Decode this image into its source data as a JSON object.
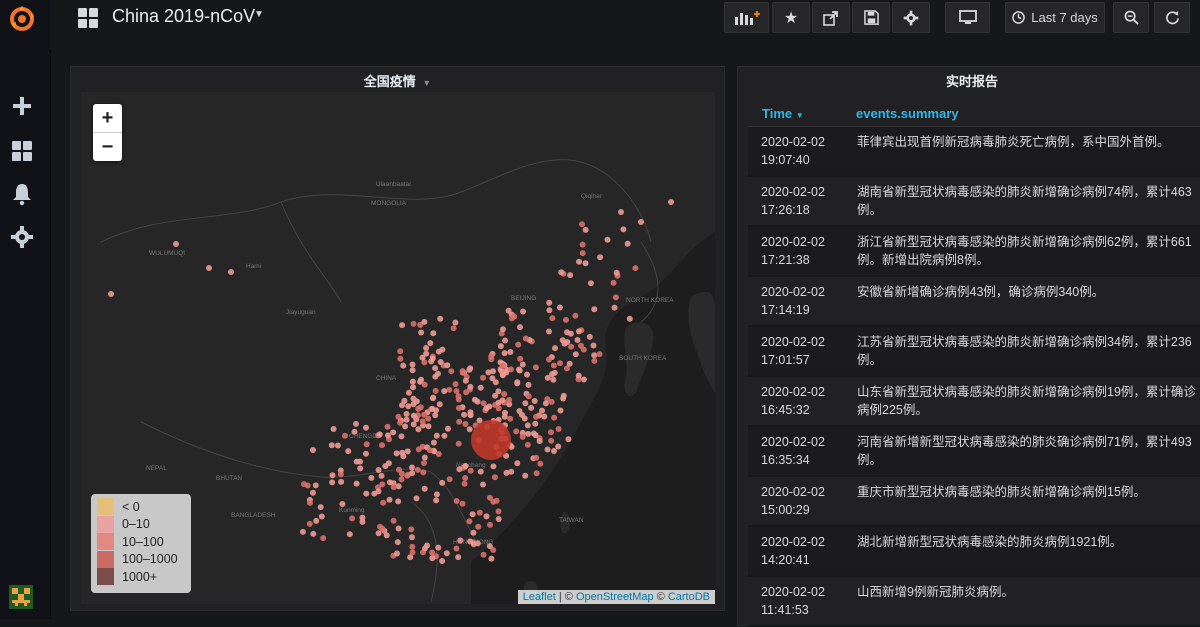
{
  "nav": {
    "title": "China 2019-nCoV",
    "time_range": "Last 7 days"
  },
  "map_panel": {
    "title": "全国疫情",
    "zoom_in": "+",
    "zoom_out": "−",
    "legend": [
      {
        "label": "< 0",
        "color": "#e5c07b"
      },
      {
        "label": "0–10",
        "color": "#e8a3a3"
      },
      {
        "label": "10–100",
        "color": "#e08a83"
      },
      {
        "label": "100–1000",
        "color": "#c96c66"
      },
      {
        "label": "1000+",
        "color": "#7b4d4a"
      }
    ],
    "attribution": {
      "leaflet": "Leaflet",
      "osm": "OpenStreetMap",
      "carto": "CartoDB",
      "sep": " | © ",
      "sep2": " © "
    },
    "map_labels": {
      "mongolia": "MONGOLIA",
      "china": "CHINA",
      "north_korea": "NORTH KOREA",
      "south_korea": "SOUTH KOREA",
      "nepal": "NEPAL",
      "bhutan": "BHUTAN",
      "bangladesh": "BANGLADESH",
      "taiwan": "TAIWAN",
      "beijing": "BEIJING",
      "chengdu": "CHENGDU",
      "wulumuqi": "WULUMUQI",
      "ulaanbaatar": "Ulaanbaatar",
      "kunming": "Kunming",
      "nanchang": "Nanchang",
      "hami": "Hami",
      "jiayuguan": "Jiayuguan",
      "hong_kong": "HONG KONG",
      "qiqihar": "Qiqihar"
    }
  },
  "table_panel": {
    "title": "实时报告",
    "col_time": "Time",
    "col_summary": "events.summary",
    "rows": [
      {
        "date": "2020-02-02",
        "time": "19:07:40",
        "summary": "菲律宾出现首例新冠病毒肺炎死亡病例，系中国外首例。"
      },
      {
        "date": "2020-02-02",
        "time": "17:26:18",
        "summary": "湖南省新型冠状病毒感染的肺炎新增确诊病例74例，累计463例。"
      },
      {
        "date": "2020-02-02",
        "time": "17:21:38",
        "summary": "浙江省新型冠状病毒感染的肺炎新增确诊病例62例，累计661例。新增出院病例8例。"
      },
      {
        "date": "2020-02-02",
        "time": "17:14:19",
        "summary": "安徽省新增确诊病例43例，确诊病例340例。"
      },
      {
        "date": "2020-02-02",
        "time": "17:01:57",
        "summary": "江苏省新型冠状病毒感染的肺炎新增确诊病例34例，累计236例。"
      },
      {
        "date": "2020-02-02",
        "time": "16:45:32",
        "summary": "山东省新型冠状病毒感染的肺炎新增确诊病例19例，累计确诊病例225例。"
      },
      {
        "date": "2020-02-02",
        "time": "16:35:34",
        "summary": "河南省新增新型冠状病毒感染的肺炎确诊病例71例，累计493例。"
      },
      {
        "date": "2020-02-02",
        "time": "15:00:29",
        "summary": "重庆市新型冠状病毒感染的肺炎新增确诊病例15例。"
      },
      {
        "date": "2020-02-02",
        "time": "14:20:41",
        "summary": "湖北新增新型冠状病毒感染的肺炎病例1921例。"
      },
      {
        "date": "2020-02-02",
        "time": "11:41:53",
        "summary": "山西新增9例新冠肺炎病例。"
      }
    ]
  },
  "colors": {
    "accent": "#33b5e5",
    "marker": "#e8837a",
    "hubei": "#c0392b"
  }
}
